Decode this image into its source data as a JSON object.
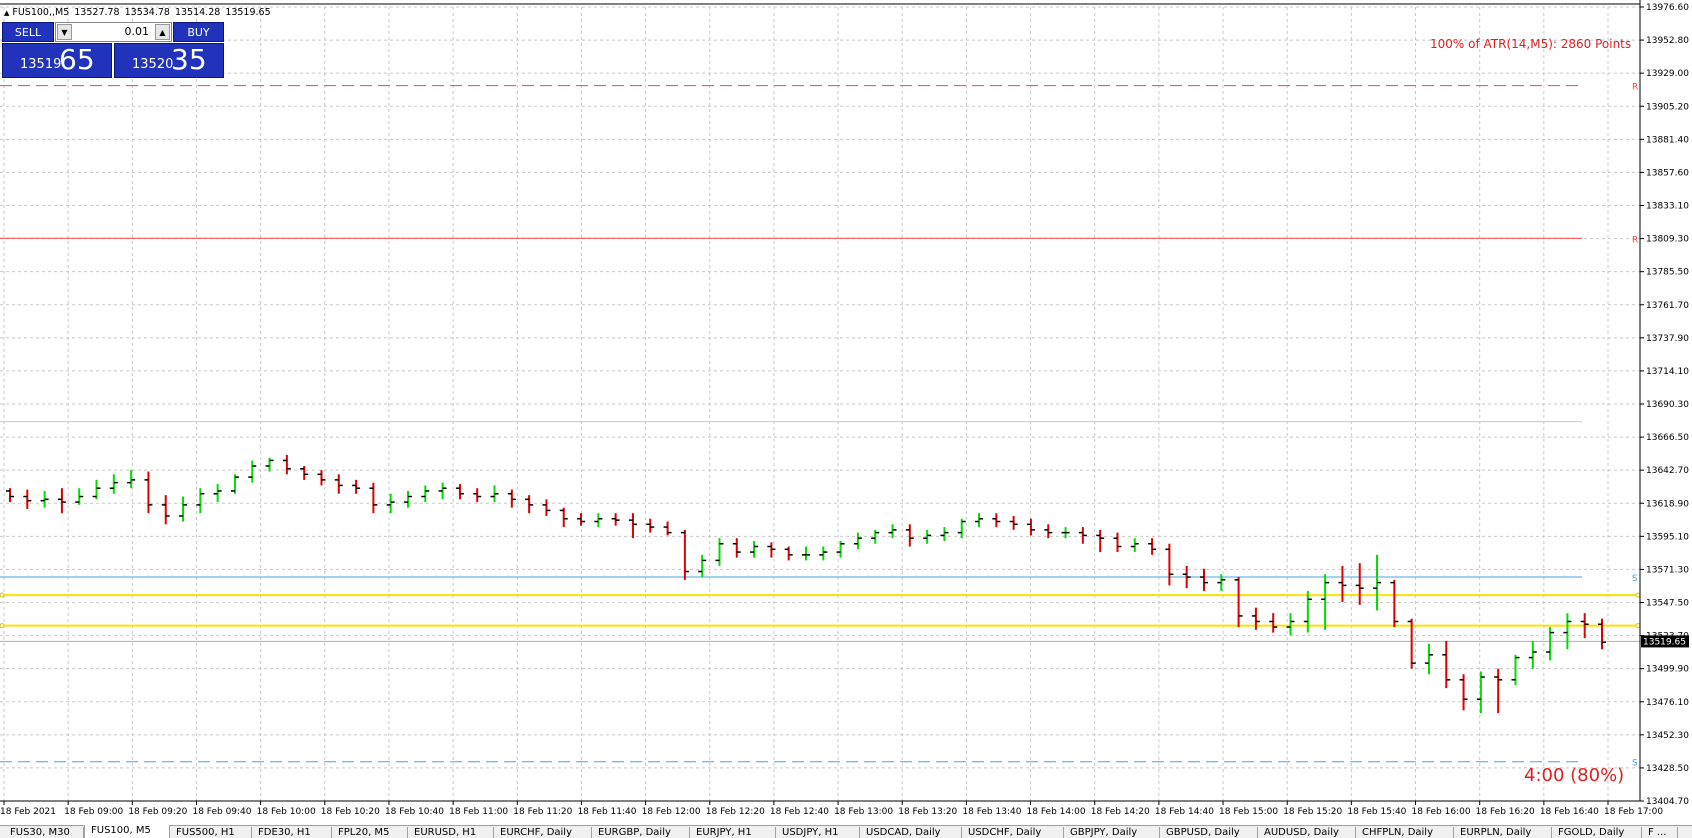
{
  "window": {
    "symbol_timeframe": "FUS100,,M5",
    "open": "13527.78",
    "high": "13534.78",
    "low": "13514.28",
    "close": "13519.65"
  },
  "trade_panel": {
    "sell_label": "SELL",
    "buy_label": "BUY",
    "lot": "0.01",
    "bid_small": "13519",
    "bid_big": "65",
    "ask_small": "13520",
    "ask_big": "35",
    "spin_down_icon": "triangle-down-icon",
    "spin_up_icon": "triangle-up-icon",
    "color": "#2233bb"
  },
  "indicators": {
    "atr_text": "100% of ATR(14,M5): 2860  Points",
    "timer_text": "4:00 (80%)",
    "color": "#e02020"
  },
  "chart_data": {
    "type": "ohlc",
    "ylim": [
      13404.7,
      13976.6
    ],
    "y_ticks": [
      "13976.60",
      "13952.80",
      "13929.00",
      "13905.20",
      "13881.40",
      "13857.60",
      "13833.10",
      "13809.30",
      "13785.50",
      "13761.70",
      "13737.90",
      "13714.10",
      "13690.30",
      "13666.50",
      "13642.70",
      "13618.90",
      "13595.10",
      "13571.30",
      "13547.50",
      "13523.70",
      "13499.90",
      "13476.10",
      "13452.30",
      "13428.50",
      "13404.70"
    ],
    "x_ticks": [
      "18 Feb 2021",
      "18 Feb 09:00",
      "18 Feb 09:20",
      "18 Feb 09:40",
      "18 Feb 10:00",
      "18 Feb 10:20",
      "18 Feb 10:40",
      "18 Feb 11:00",
      "18 Feb 11:20",
      "18 Feb 11:40",
      "18 Feb 12:00",
      "18 Feb 12:20",
      "18 Feb 12:40",
      "18 Feb 13:00",
      "18 Feb 13:20",
      "18 Feb 13:40",
      "18 Feb 14:00",
      "18 Feb 14:20",
      "18 Feb 14:40",
      "18 Feb 15:00",
      "18 Feb 15:20",
      "18 Feb 15:40",
      "18 Feb 16:00",
      "18 Feb 16:20",
      "18 Feb 16:40",
      "18 Feb 17:00"
    ],
    "grid": true,
    "current_price": "13519.65",
    "bull_color": "#00dd00",
    "bear_color": "#dd0000",
    "levels": [
      {
        "price": 13920,
        "color": "#ff4040",
        "style": "dashed",
        "tag": "R"
      },
      {
        "price": 13810,
        "color": "#ff4040",
        "style": "solid",
        "tag": "R"
      },
      {
        "price": 13678,
        "color": "#c8c8c8",
        "style": "solid",
        "tag": ""
      },
      {
        "price": 13566,
        "color": "#4aa3df",
        "style": "solid",
        "tag": "S"
      },
      {
        "price": 13553,
        "color": "#ffe000",
        "style": "solid",
        "tag": ""
      },
      {
        "price": 13531,
        "color": "#ffe000",
        "style": "solid",
        "tag": ""
      },
      {
        "price": 13433,
        "color": "#4aa3df",
        "style": "dashed",
        "tag": "S"
      }
    ],
    "bars": [
      [
        13628,
        13630,
        13620,
        13624
      ],
      [
        13624,
        13629,
        13615,
        13621
      ],
      [
        13621,
        13628,
        13616,
        13622
      ],
      [
        13622,
        13630,
        13612,
        13620
      ],
      [
        13620,
        13630,
        13618,
        13624
      ],
      [
        13624,
        13636,
        13622,
        13630
      ],
      [
        13630,
        13640,
        13626,
        13634
      ],
      [
        13634,
        13643,
        13630,
        13636
      ],
      [
        13636,
        13642,
        13612,
        13618
      ],
      [
        13618,
        13625,
        13604,
        13610
      ],
      [
        13610,
        13624,
        13606,
        13618
      ],
      [
        13618,
        13630,
        13612,
        13626
      ],
      [
        13626,
        13633,
        13620,
        13628
      ],
      [
        13628,
        13640,
        13626,
        13638
      ],
      [
        13638,
        13650,
        13634,
        13646
      ],
      [
        13646,
        13652,
        13642,
        13650
      ],
      [
        13650,
        13654,
        13640,
        13644
      ],
      [
        13644,
        13646,
        13636,
        13640
      ],
      [
        13640,
        13643,
        13632,
        13636
      ],
      [
        13636,
        13640,
        13626,
        13632
      ],
      [
        13632,
        13636,
        13626,
        13630
      ],
      [
        13630,
        13634,
        13612,
        13618
      ],
      [
        13618,
        13626,
        13612,
        13620
      ],
      [
        13620,
        13628,
        13616,
        13624
      ],
      [
        13624,
        13632,
        13620,
        13628
      ],
      [
        13628,
        13634,
        13622,
        13630
      ],
      [
        13630,
        13633,
        13622,
        13626
      ],
      [
        13626,
        13630,
        13620,
        13624
      ],
      [
        13624,
        13632,
        13620,
        13626
      ],
      [
        13626,
        13629,
        13616,
        13622
      ],
      [
        13622,
        13625,
        13612,
        13618
      ],
      [
        13618,
        13622,
        13610,
        13614
      ],
      [
        13614,
        13616,
        13602,
        13608
      ],
      [
        13608,
        13612,
        13603,
        13606
      ],
      [
        13606,
        13612,
        13602,
        13608
      ],
      [
        13608,
        13612,
        13603,
        13607
      ],
      [
        13607,
        13612,
        13594,
        13604
      ],
      [
        13604,
        13608,
        13598,
        13602
      ],
      [
        13602,
        13606,
        13596,
        13598
      ],
      [
        13598,
        13600,
        13564,
        13570
      ],
      [
        13570,
        13582,
        13566,
        13578
      ],
      [
        13578,
        13594,
        13574,
        13590
      ],
      [
        13590,
        13594,
        13580,
        13584
      ],
      [
        13584,
        13592,
        13580,
        13588
      ],
      [
        13588,
        13591,
        13580,
        13586
      ],
      [
        13586,
        13588,
        13578,
        13582
      ],
      [
        13582,
        13588,
        13578,
        13582
      ],
      [
        13582,
        13588,
        13578,
        13584
      ],
      [
        13584,
        13592,
        13580,
        13590
      ],
      [
        13590,
        13598,
        13586,
        13594
      ],
      [
        13594,
        13600,
        13590,
        13598
      ],
      [
        13598,
        13604,
        13594,
        13600
      ],
      [
        13600,
        13604,
        13588,
        13594
      ],
      [
        13594,
        13600,
        13590,
        13596
      ],
      [
        13596,
        13602,
        13592,
        13598
      ],
      [
        13598,
        13608,
        13594,
        13606
      ],
      [
        13606,
        13612,
        13602,
        13608
      ],
      [
        13608,
        13612,
        13602,
        13606
      ],
      [
        13606,
        13610,
        13600,
        13604
      ],
      [
        13604,
        13608,
        13596,
        13600
      ],
      [
        13600,
        13604,
        13594,
        13598
      ],
      [
        13598,
        13602,
        13594,
        13598
      ],
      [
        13598,
        13602,
        13590,
        13596
      ],
      [
        13596,
        13600,
        13584,
        13594
      ],
      [
        13594,
        13598,
        13584,
        13588
      ],
      [
        13588,
        13594,
        13584,
        13590
      ],
      [
        13590,
        13594,
        13582,
        13586
      ],
      [
        13586,
        13590,
        13560,
        13568
      ],
      [
        13568,
        13574,
        13558,
        13566
      ],
      [
        13566,
        13572,
        13556,
        13562
      ],
      [
        13562,
        13568,
        13556,
        13564
      ],
      [
        13564,
        13566,
        13530,
        13538
      ],
      [
        13538,
        13544,
        13528,
        13534
      ],
      [
        13534,
        13540,
        13526,
        13530
      ],
      [
        13530,
        13540,
        13524,
        13534
      ],
      [
        13534,
        13556,
        13526,
        13550
      ],
      [
        13550,
        13568,
        13528,
        13562
      ],
      [
        13562,
        13574,
        13548,
        13560
      ],
      [
        13560,
        13576,
        13546,
        13558
      ],
      [
        13558,
        13582,
        13542,
        13562
      ],
      [
        13562,
        13564,
        13530,
        13534
      ],
      [
        13534,
        13536,
        13500,
        13504
      ],
      [
        13504,
        13518,
        13496,
        13510
      ],
      [
        13510,
        13520,
        13486,
        13492
      ],
      [
        13492,
        13496,
        13470,
        13478
      ],
      [
        13478,
        13498,
        13468,
        13494
      ],
      [
        13494,
        13500,
        13468,
        13492
      ],
      [
        13492,
        13510,
        13488,
        13508
      ],
      [
        13508,
        13520,
        13500,
        13512
      ],
      [
        13512,
        13530,
        13506,
        13526
      ],
      [
        13526,
        13540,
        13514,
        13534
      ],
      [
        13534,
        13540,
        13522,
        13532
      ],
      [
        13532,
        13536,
        13514,
        13519
      ]
    ]
  },
  "tabs": [
    {
      "label": "FUS30, M30",
      "active": false
    },
    {
      "label": "FUS100, M5",
      "active": true
    },
    {
      "label": "FUS500, H1",
      "active": false
    },
    {
      "label": "FDE30, H1",
      "active": false
    },
    {
      "label": "FPL20, M5",
      "active": false
    },
    {
      "label": "EURUSD, H1",
      "active": false
    },
    {
      "label": "EURCHF, Daily",
      "active": false
    },
    {
      "label": "EURGBP, Daily",
      "active": false
    },
    {
      "label": "EURJPY, H1",
      "active": false
    },
    {
      "label": "USDJPY, H1",
      "active": false
    },
    {
      "label": "USDCAD, Daily",
      "active": false
    },
    {
      "label": "USDCHF, Daily",
      "active": false
    },
    {
      "label": "GBPJPY, Daily",
      "active": false
    },
    {
      "label": "GBPUSD, Daily",
      "active": false
    },
    {
      "label": "AUDUSD, Daily",
      "active": false
    },
    {
      "label": "CHFPLN, Daily",
      "active": false
    },
    {
      "label": "EURPLN, Daily",
      "active": false
    },
    {
      "label": "FGOLD, Daily",
      "active": false
    },
    {
      "label": "F ...",
      "active": false
    }
  ]
}
